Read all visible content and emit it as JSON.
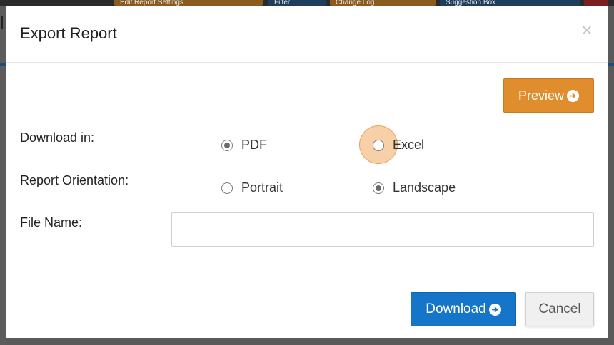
{
  "background": {
    "top_buttons": [
      {
        "label": "Edit Report Settings"
      },
      {
        "label": "Filter"
      },
      {
        "label": "Change Log"
      },
      {
        "label": "Suggestion Box"
      }
    ]
  },
  "modal": {
    "title": "Export Report",
    "close_label": "×",
    "preview_label": "Preview",
    "download_in": {
      "label": "Download in:",
      "options": [
        {
          "label": "PDF",
          "checked": true
        },
        {
          "label": "Excel",
          "checked": false
        }
      ]
    },
    "orientation": {
      "label": "Report Orientation:",
      "options": [
        {
          "label": "Portrait",
          "checked": false
        },
        {
          "label": "Landscape",
          "checked": true
        }
      ]
    },
    "file_name": {
      "label": "File Name:",
      "value": "",
      "placeholder": ""
    },
    "download_label": "Download",
    "cancel_label": "Cancel"
  },
  "colors": {
    "preview_button": "#e08e2d",
    "download_button": "#1576c9",
    "click_highlight": "#f0963c"
  },
  "icons": {
    "preview": "arrow-circle-right-icon",
    "download": "arrow-circle-right-icon",
    "close": "close-icon"
  }
}
